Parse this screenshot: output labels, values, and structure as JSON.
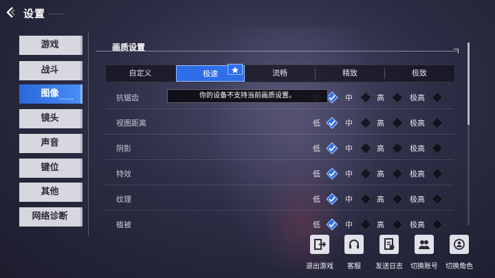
{
  "header": {
    "title": "设置",
    "title_dots": "......"
  },
  "sidebar": {
    "items": [
      {
        "label": "游戏",
        "active": false
      },
      {
        "label": "战斗",
        "active": false
      },
      {
        "label": "图像",
        "active": true
      },
      {
        "label": "镜头",
        "active": false
      },
      {
        "label": "声音",
        "active": false
      },
      {
        "label": "键位",
        "active": false
      },
      {
        "label": "其他",
        "active": false
      },
      {
        "label": "网络诊断",
        "active": false
      }
    ],
    "active_dots": "........"
  },
  "section": {
    "title": "画质设置"
  },
  "presets": {
    "items": [
      "自定义",
      "极速",
      "流畅",
      "精致",
      "极致"
    ],
    "selected": "极速"
  },
  "tooltip": "你的设备不支持当前画质设置。",
  "settings": {
    "options": [
      "低",
      "中",
      "高",
      "极高"
    ],
    "rows": [
      {
        "label": "抗锯齿",
        "selected": "低"
      },
      {
        "label": "视图距离",
        "selected": "低"
      },
      {
        "label": "阴影",
        "selected": "低"
      },
      {
        "label": "特效",
        "selected": "低"
      },
      {
        "label": "纹理",
        "selected": "低"
      },
      {
        "label": "植被",
        "selected": "低"
      }
    ]
  },
  "bottom_buttons": [
    {
      "label": "退出游戏",
      "icon": "exit-door-icon"
    },
    {
      "label": "客服",
      "icon": "headset-icon"
    },
    {
      "label": "发送日志",
      "icon": "send-log-icon"
    },
    {
      "label": "切换账号",
      "icon": "switch-account-icon"
    },
    {
      "label": "切换角色",
      "icon": "switch-character-icon"
    }
  ],
  "colors": {
    "accent": "#2e6ee8",
    "sidebar_bg": "#e6e6ee",
    "background": "#2c2c44"
  }
}
